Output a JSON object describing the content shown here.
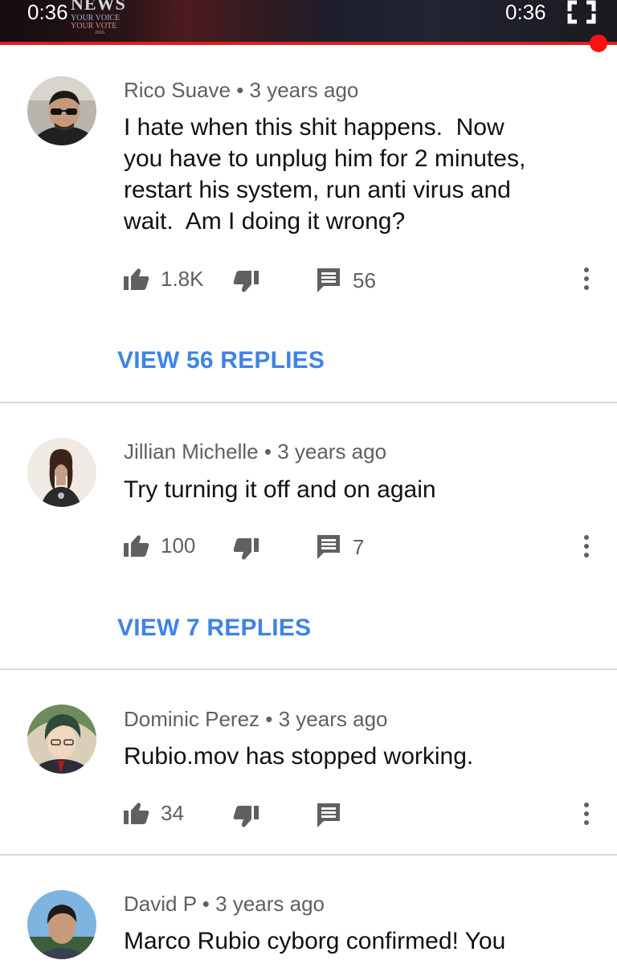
{
  "player": {
    "time_current": "0:36",
    "time_total": "0:36",
    "thumbnail_logo": {
      "network": "NEWS",
      "slogan_line1": "YOUR VOICE",
      "slogan_line2": "YOUR VOTE",
      "year": "2016"
    },
    "progress_fraction": 0.97,
    "progress_color": "#e02020"
  },
  "comments": [
    {
      "author": "Rico Suave",
      "age": "3 years ago",
      "text_lines": [
        "I hate when this shit happens.  Now",
        "you have to unplug him for 2 minutes,",
        "restart his system, run anti virus and",
        "wait.  Am I doing it wrong?"
      ],
      "likes": "1.8K",
      "reply_count": "56",
      "view_replies": "VIEW 56 REPLIES"
    },
    {
      "author": "Jillian Michelle",
      "age": "3 years ago",
      "text_lines": [
        "Try turning it off and on again"
      ],
      "likes": "100",
      "reply_count": "7",
      "view_replies": "VIEW 7 REPLIES"
    },
    {
      "author": "Dominic Perez",
      "age": "3 years ago",
      "text_lines": [
        "Rubio.mov has stopped working."
      ],
      "likes": "34",
      "reply_count": ""
    },
    {
      "author": "David P",
      "age": "3 years ago",
      "text_lines": [
        "Marco Rubio cyborg confirmed! You"
      ]
    }
  ],
  "separator": " • ",
  "icons": {
    "like": "thumb-up-icon",
    "dislike": "thumb-down-icon",
    "reply": "comment-icon",
    "more": "more-vert-icon",
    "fullscreen": "fullscreen-icon"
  },
  "colors": {
    "link": "#3e83e6",
    "meta": "#606060",
    "text": "#111111"
  }
}
